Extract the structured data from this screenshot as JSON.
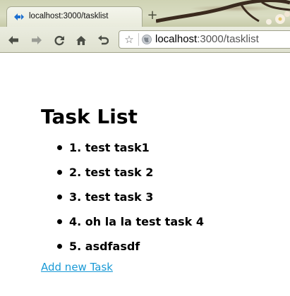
{
  "browser": {
    "tab": {
      "title": "localhost:3000/tasklist",
      "favicon": "rails-favicon-icon"
    },
    "new_tab_label": "+",
    "toolbar": {
      "back_icon": "back-arrow-icon",
      "forward_icon": "forward-arrow-icon",
      "reload_icon": "reload-icon",
      "home_icon": "home-icon",
      "history_icon": "history-undo-icon"
    },
    "address_bar": {
      "bookmark_icon": "star-icon",
      "site_icon": "globe-icon",
      "url_host": "localhost",
      "url_rest": ":3000/tasklist"
    }
  },
  "page": {
    "title": "Task List",
    "tasks": [
      {
        "label": "1. test task1"
      },
      {
        "label": "2. test task 2"
      },
      {
        "label": "3. test task 3"
      },
      {
        "label": "4. oh la la test task 4"
      },
      {
        "label": "5. asdfasdf"
      }
    ],
    "add_link": "Add new Task"
  },
  "colors": {
    "link": "#1a9ad6",
    "chrome": "#dfe1d0"
  }
}
